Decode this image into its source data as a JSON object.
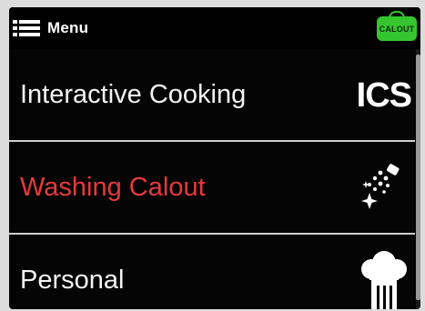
{
  "header": {
    "menu_icon": "list-icon",
    "menu_label": "Menu",
    "badge_text": "CALOUT",
    "badge_color": "#35c62f"
  },
  "menu": {
    "items": [
      {
        "label": "Interactive Cooking",
        "icon": "ics-logo",
        "icon_text": "ICS",
        "selected": false
      },
      {
        "label": "Washing Calout",
        "icon": "sparkle-spray-icon",
        "selected": true
      },
      {
        "label": "Personal",
        "icon": "chef-hat-icon",
        "selected": false
      }
    ]
  },
  "colors": {
    "background": "#050505",
    "text": "#f4f4f4",
    "selected_text": "#e8383d",
    "divider": "#cfcfcf"
  }
}
